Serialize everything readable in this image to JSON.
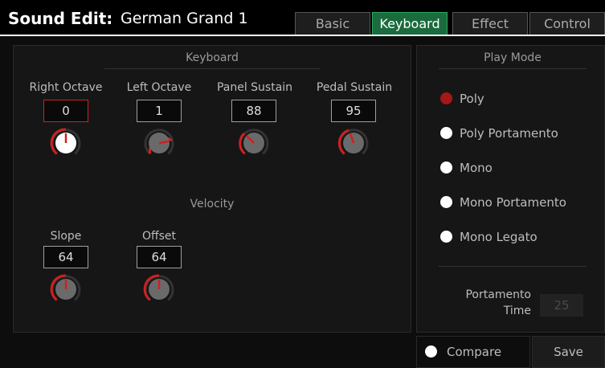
{
  "header": {
    "title_bold": "Sound Edit:",
    "title_name": "German Grand 1",
    "tabs": [
      {
        "label": "Basic",
        "active": false
      },
      {
        "label": "Keyboard",
        "active": true
      },
      {
        "label": "Effect",
        "active": false
      },
      {
        "label": "Control",
        "active": false
      }
    ]
  },
  "keyboard": {
    "section_label": "Keyboard",
    "params": [
      {
        "label": "Right Octave",
        "value": "0",
        "selected": true
      },
      {
        "label": "Left Octave",
        "value": "1",
        "selected": false
      },
      {
        "label": "Panel Sustain",
        "value": "88",
        "selected": false
      },
      {
        "label": "Pedal Sustain",
        "value": "95",
        "selected": false
      }
    ]
  },
  "velocity": {
    "section_label": "Velocity",
    "params": [
      {
        "label": "Slope",
        "value": "64"
      },
      {
        "label": "Offset",
        "value": "64"
      }
    ]
  },
  "play_mode": {
    "section_label": "Play Mode",
    "options": [
      {
        "label": "Poly",
        "selected": true
      },
      {
        "label": "Poly Portamento",
        "selected": false
      },
      {
        "label": "Mono",
        "selected": false
      },
      {
        "label": "Mono Portamento",
        "selected": false
      },
      {
        "label": "Mono Legato",
        "selected": false
      }
    ],
    "portamento_label_1": "Portamento",
    "portamento_label_2": "Time",
    "portamento_value": "25"
  },
  "footer": {
    "compare_label": "Compare",
    "save_label": "Save"
  },
  "colors": {
    "accent_red": "#d02020",
    "tab_active": "#1a6b3d"
  }
}
